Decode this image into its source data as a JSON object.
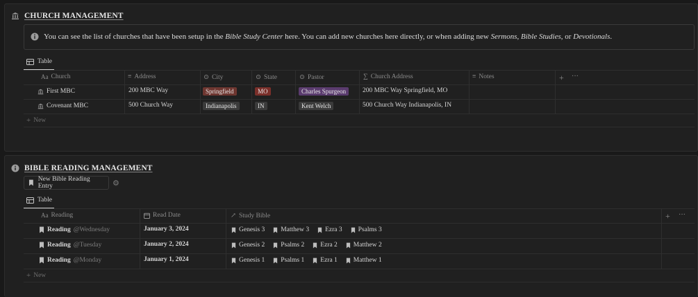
{
  "church": {
    "title": "CHURCH MANAGEMENT",
    "callout": {
      "t1": "You can see the list of churches that have been setup in the ",
      "i1": "Bible Study Center",
      "t2": " here. You can add new churches here directly, or when adding new ",
      "i2": "Sermons",
      "t3": ", ",
      "i3": "Bible Studies",
      "t4": ", or ",
      "i4": "Devotionals",
      "t5": "."
    },
    "view_tab": "Table",
    "columns": {
      "church": "Church",
      "address": "Address",
      "city": "City",
      "state": "State",
      "pastor": "Pastor",
      "church_address": "Church Address",
      "notes": "Notes"
    },
    "rows": [
      {
        "church": "First MBC",
        "address": "200 MBC Way",
        "city": "Springfield",
        "state": "MO",
        "pastor": "Charles Spurgeon",
        "church_address": "200 MBC Way Springfield, MO"
      },
      {
        "church": "Covenant MBC",
        "address": "500 Church Way",
        "city": "Indianapolis",
        "state": "IN",
        "pastor": "Kent Welch",
        "church_address": "500 Church Way Indianapolis, IN"
      }
    ],
    "new_label": "New",
    "colors": {
      "springfield": "#6e3630",
      "mo": "#7a2f2a",
      "charles": "#5a3b6e",
      "indianapolis": "#3b3b3b",
      "in": "#3b3b3b",
      "kent": "#3b3b3b"
    }
  },
  "bible": {
    "title": "BIBLE READING MANAGEMENT",
    "new_entry_button": "New Bible Reading Entry",
    "view_tab": "Table",
    "columns": {
      "reading": "Reading",
      "read_date": "Read Date",
      "study_bible": "Study Bible"
    },
    "rows": [
      {
        "reading": "Reading",
        "day": "@Wednesday",
        "date": "January 3, 2024",
        "books": [
          "Genesis 3",
          "Matthew 3",
          "Ezra 3",
          "Psalms 3"
        ]
      },
      {
        "reading": "Reading",
        "day": "@Tuesday",
        "date": "January 2, 2024",
        "books": [
          "Genesis 2",
          "Psalms 2",
          "Ezra 2",
          "Matthew 2"
        ]
      },
      {
        "reading": "Reading",
        "day": "@Monday",
        "date": "January 1, 2024",
        "books": [
          "Genesis 1",
          "Psalms 1",
          "Ezra 1",
          "Matthew 1"
        ]
      }
    ],
    "new_label": "New"
  },
  "icons": [
    "bank-icon",
    "info-icon",
    "table-icon",
    "text-icon",
    "list-icon",
    "select-icon",
    "formula-icon",
    "plus-icon",
    "more-icon",
    "bookmark-icon",
    "gear-icon",
    "calendar-icon",
    "relation-arrow-icon"
  ]
}
